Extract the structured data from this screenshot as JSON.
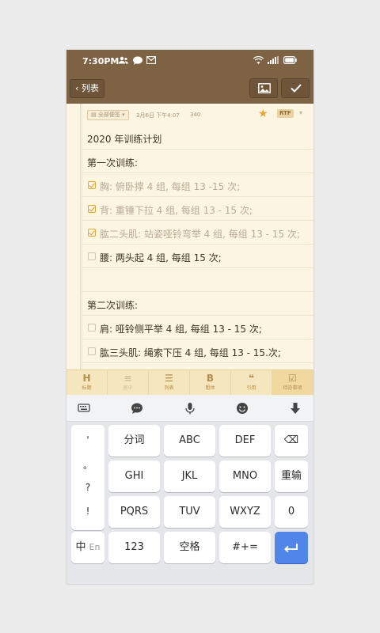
{
  "status_bar": {
    "time": "7:30PM"
  },
  "toolbar": {
    "back_label": "列表"
  },
  "note": {
    "tag": "全部便签",
    "date": "3月6日 下午4:07",
    "char_count": "340",
    "format_badge": "RTF",
    "lines": [
      {
        "text": "2020 年训练计划",
        "type": "text"
      },
      {
        "text": "第一次训练:",
        "type": "text"
      },
      {
        "text": "胸: 俯卧撑 4 组, 每组 13 -15 次;",
        "type": "task",
        "checked": true
      },
      {
        "text": "背: 重锤下拉 4 组, 每组 13 - 15 次;",
        "type": "task",
        "checked": true
      },
      {
        "text": "肱二头肌: 站姿哑铃弯举 4 组, 每组 13 - 15 次;",
        "type": "task",
        "checked": true
      },
      {
        "text": "腰: 两头起 4 组, 每组 15 次;",
        "type": "task",
        "checked": false
      },
      {
        "text": "",
        "type": "text"
      },
      {
        "text": "第二次训练:",
        "type": "text"
      },
      {
        "text": "肩: 哑铃侧平举 4 组, 每组 13 - 15 次;",
        "type": "task",
        "checked": false
      },
      {
        "text": "肱三头肌: 绳索下压 4 组, 每组 13 - 15.次;",
        "type": "task",
        "checked": false
      }
    ]
  },
  "format_bar": [
    {
      "icon": "H",
      "label": "标题",
      "state": "normal"
    },
    {
      "icon": "≡",
      "label": "居中",
      "state": "dim"
    },
    {
      "icon": "☰",
      "label": "列表",
      "state": "normal"
    },
    {
      "icon": "B",
      "label": "粗体",
      "state": "normal"
    },
    {
      "icon": "❝",
      "label": "引用",
      "state": "normal"
    },
    {
      "icon": "☑",
      "label": "待办事项",
      "state": "active"
    }
  ],
  "keyboard": {
    "symbols": [
      "'",
      "。",
      "?",
      "!"
    ],
    "rows": [
      [
        "分词",
        "ABC",
        "DEF"
      ],
      [
        "GHI",
        "JKL",
        "MNO",
        "重输"
      ],
      [
        "PQRS",
        "TUV",
        "WXYZ",
        "0"
      ]
    ],
    "right_top": "⌫",
    "lang_primary": "中",
    "lang_secondary": "En",
    "num_key": "123",
    "space_key": "空格",
    "sym_key": "#+="
  }
}
